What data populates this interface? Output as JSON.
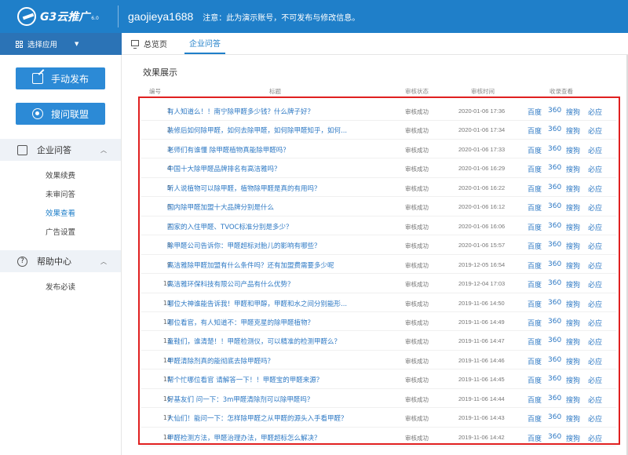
{
  "header": {
    "logo_text": "G3云推广",
    "logo_version": "6.0",
    "username": "gaojieya1688",
    "notice": "注意：此为演示账号，不可发布与修改信息。"
  },
  "appbar": {
    "label": "选择应用"
  },
  "tabs": [
    {
      "label": "总览页"
    },
    {
      "label": "企业问答"
    }
  ],
  "sidebar": {
    "publish_button": "手动发布",
    "alliance_button": "搜问联盟",
    "qa_section": "企业问答",
    "qa_items": [
      "效果续费",
      "未审问答",
      "效果查看",
      "广告设置"
    ],
    "help_section": "帮助中心",
    "help_items": [
      "发布必读"
    ]
  },
  "main": {
    "title": "效果展示",
    "columns": {
      "num": "编号",
      "title": "标题",
      "status": "审核状态",
      "time": "审核时间",
      "collect": "收录查看"
    },
    "engines": [
      "百度",
      "360",
      "搜狗",
      "必应"
    ],
    "rows": [
      {
        "num": "1",
        "title": "有人知道么！！南宁除甲醛多少钱？什么牌子好？",
        "status": "审核成功",
        "time": "2020-01-06 17:36"
      },
      {
        "num": "2",
        "title": "装修后如何除甲醛，如何去除甲醛，如何除甲醛知乎，如何...",
        "status": "审核成功",
        "time": "2020-01-06 17:34"
      },
      {
        "num": "3",
        "title": "老师们有谁懂 除甲醛植物真能除甲醛吗？",
        "status": "审核成功",
        "time": "2020-01-06 17:33"
      },
      {
        "num": "4",
        "title": "中国十大除甲醛品牌排名有高洁雅吗？",
        "status": "审核成功",
        "time": "2020-01-06 16:29"
      },
      {
        "num": "5",
        "title": "听人说植物可以除甲醛，植物除甲醛是真的有用吗？",
        "status": "审核成功",
        "time": "2020-01-06 16:22"
      },
      {
        "num": "6",
        "title": "国内除甲醛加盟十大品牌分别是什么",
        "status": "审核成功",
        "time": "2020-01-06 16:12"
      },
      {
        "num": "7",
        "title": "国家的入住甲醛、TVOC标准分别是多少？",
        "status": "审核成功",
        "time": "2020-01-06 16:06"
      },
      {
        "num": "8",
        "title": "除甲醛公司告诉你：甲醛超标对胎儿的影响有哪些？",
        "status": "审核成功",
        "time": "2020-01-06 15:57"
      },
      {
        "num": "9",
        "title": "高洁雅除甲醛加盟有什么条件吗？还有加盟费需要多少呢",
        "status": "审核成功",
        "time": "2019-12-05 16:54"
      },
      {
        "num": "10",
        "title": "高洁雅环保科技有限公司产品有什么优势？",
        "status": "审核成功",
        "time": "2019-12-04 17:03"
      },
      {
        "num": "11",
        "title": "哪位大神谁能告诉我！甲醛和甲醇，甲醛和水之间分别能形...",
        "status": "审核成功",
        "time": "2019-11-06 14:50"
      },
      {
        "num": "12",
        "title": "哪位看官，有人知道不：甲醛克星的除甲醛植物？",
        "status": "审核成功",
        "time": "2019-11-06 14:49"
      },
      {
        "num": "13",
        "title": "童鞋们，谁清楚！！甲醛检测仪，可以精准的检测甲醛么？",
        "status": "审核成功",
        "time": "2019-11-06 14:47"
      },
      {
        "num": "14",
        "title": "甲醛清除剂真的能彻底去除甲醛吗？",
        "status": "审核成功",
        "time": "2019-11-06 14:46"
      },
      {
        "num": "15",
        "title": "帮个忙哪位看官 请解答一下！！甲醛宝的甲醛来源？",
        "status": "审核成功",
        "time": "2019-11-06 14:45"
      },
      {
        "num": "16",
        "title": "好基友们 问一下：3m甲醛清除剂可以除甲醛吗？",
        "status": "审核成功",
        "time": "2019-11-06 14:44"
      },
      {
        "num": "17",
        "title": "大仙们！能问一下：怎样除甲醛之从甲醛的源头入手看甲醛？",
        "status": "审核成功",
        "time": "2019-11-06 14:43"
      },
      {
        "num": "18",
        "title": "甲醛检测方法，甲醛治理办法，甲醛超标怎么解决？",
        "status": "审核成功",
        "time": "2019-11-06 14:42"
      }
    ]
  }
}
